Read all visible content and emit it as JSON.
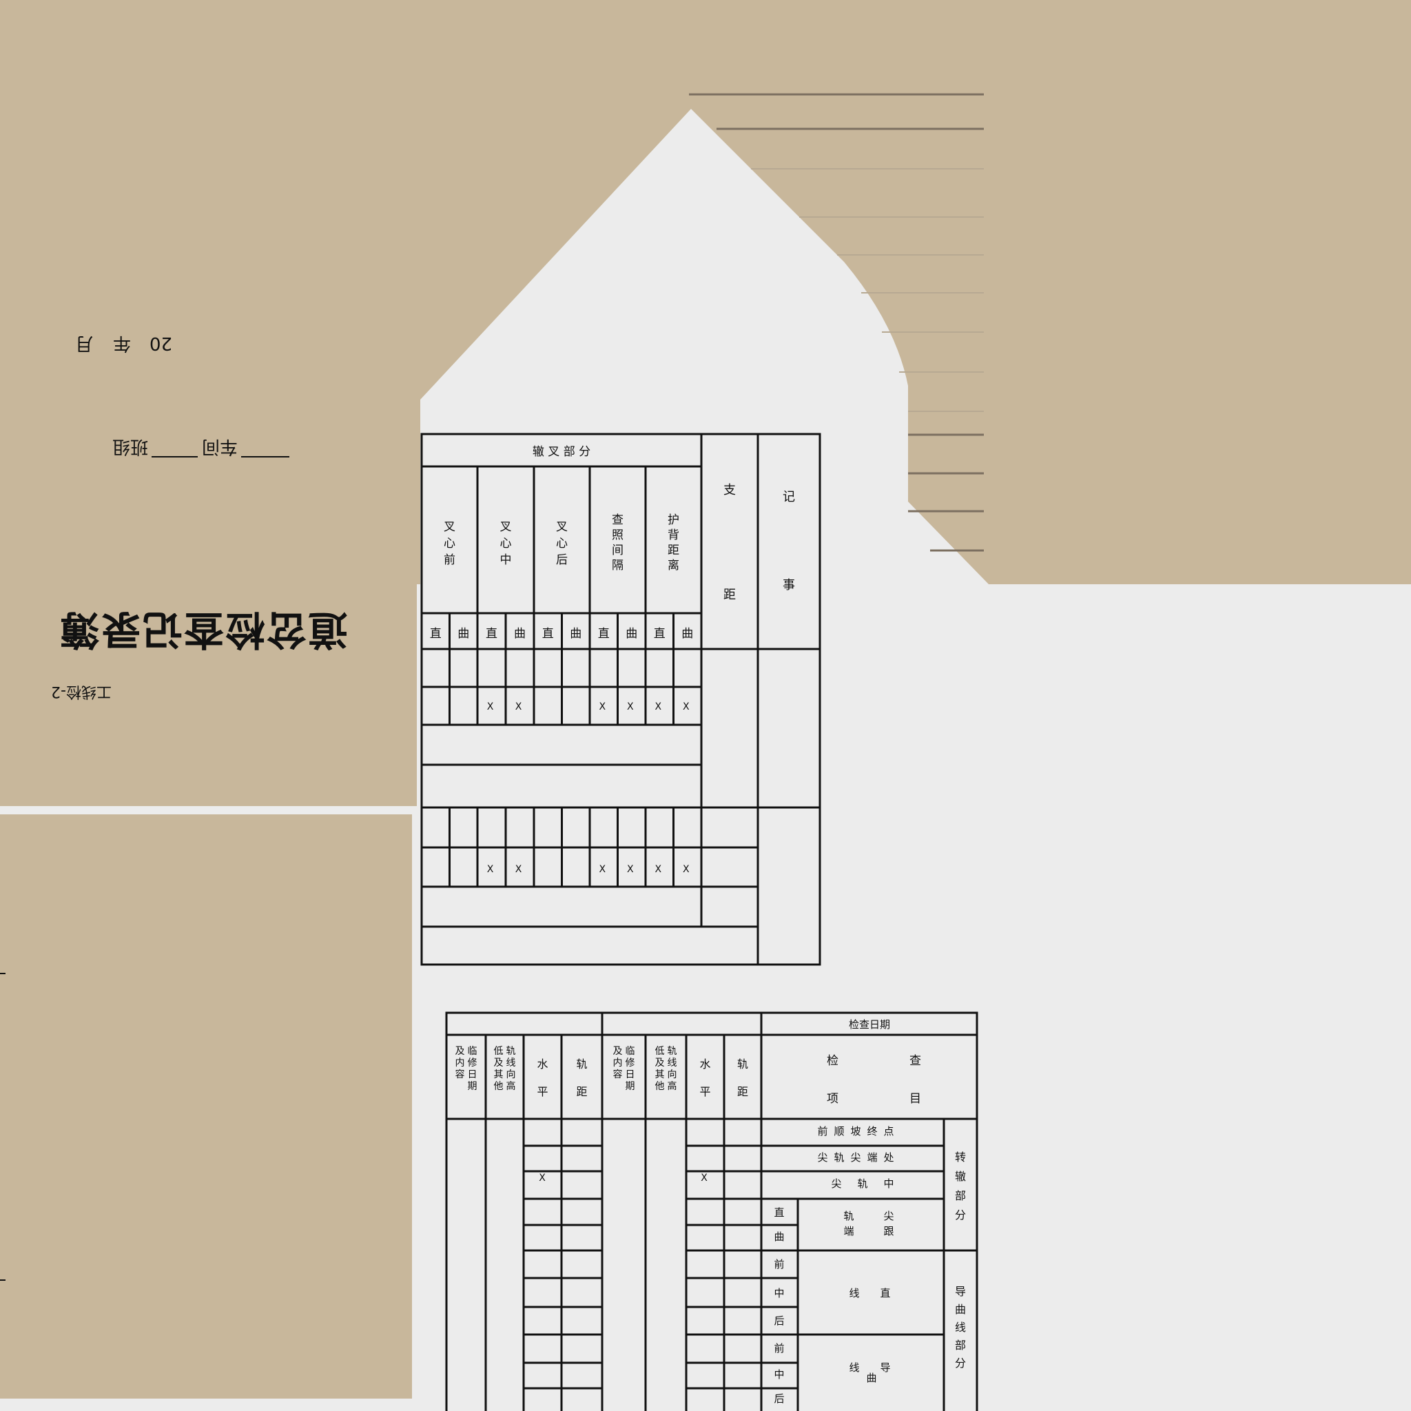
{
  "cover": {
    "form_code": "工线检-2",
    "title": "道岔检查记录簿",
    "dept_line": [
      "车间",
      "班组"
    ],
    "date_line": [
      "20",
      "年",
      "月"
    ]
  },
  "frog_table": {
    "header": "辙 叉 部 分",
    "columns": [
      "叉心前",
      "叉心中",
      "叉心后",
      "查照间隔",
      "护背距离"
    ],
    "right_cols": [
      "支 距",
      "记 事"
    ],
    "sub": [
      "直",
      "曲"
    ],
    "mark": "X"
  },
  "switch_table": {
    "header_right": "检查日期",
    "check_items": "检 查 项 目",
    "group_cols": [
      "轨 距",
      "水 平",
      "轨线向高低及其他",
      "临修日期及内容"
    ],
    "rows_a": [
      "前顺坡终点",
      "尖轨尖端处",
      "尖 轨 中"
    ],
    "row_b": "尖轨跟端",
    "section_a": "转辙部分",
    "row_c": "直 线",
    "row_d": "导曲线",
    "section_b": "导曲线部分",
    "sub_zq": [
      "直",
      "曲"
    ],
    "sub_qzh": [
      "前",
      "中",
      "后"
    ],
    "mark": "X"
  }
}
